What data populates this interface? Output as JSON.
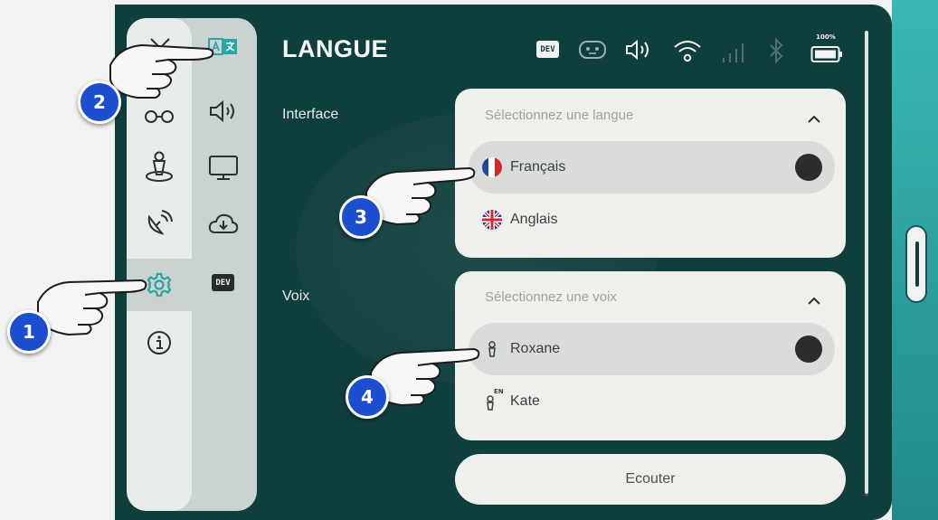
{
  "header": {
    "title": "LANGUE"
  },
  "status_bar": {
    "dev_badge": "DEV",
    "icons": [
      "dev-badge",
      "robot-face-icon",
      "volume-icon",
      "wifi-icon",
      "signal-bars-icon",
      "bluetooth-icon",
      "battery-icon"
    ],
    "battery_label": "100%"
  },
  "sidebar": {
    "left_column": [
      "bot-head-icon",
      "glasses-icon",
      "person-on-platform-icon",
      "satellite-dish-icon",
      "settings-gear-icon",
      "info-icon"
    ],
    "right_column": [
      "language-translate-icon",
      "sound-icon",
      "monitor-icon",
      "cloud-download-icon",
      "dev-badge"
    ],
    "dev_label": "DEV",
    "active_item": "settings-gear-icon",
    "highlighted_item": "language-translate-icon"
  },
  "interface_section": {
    "label": "Interface",
    "placeholder": "Sélectionnez une langue",
    "options": [
      {
        "label": "Français",
        "icon": "flag-france-icon",
        "selected": true
      },
      {
        "label": "Anglais",
        "icon": "flag-uk-icon",
        "selected": false
      }
    ]
  },
  "voice_section": {
    "label": "Voix",
    "placeholder": "Sélectionnez une voix",
    "options": [
      {
        "label": "Roxane",
        "icon": "voice-person-icon",
        "badge": "",
        "selected": true
      },
      {
        "label": "Kate",
        "icon": "voice-person-icon",
        "badge": "EN",
        "selected": false
      }
    ]
  },
  "listen_button": {
    "label": "Ecouter"
  },
  "callouts": [
    "1",
    "2",
    "3",
    "4"
  ],
  "colors": {
    "tablet_bg": "#0f3f3d",
    "edge_teal": "#39b8b5",
    "card_bg": "#efefec",
    "selected_row": "#dadcd9",
    "accent_teal": "#3ac6c3",
    "callout_blue": "#1b4fd0"
  }
}
